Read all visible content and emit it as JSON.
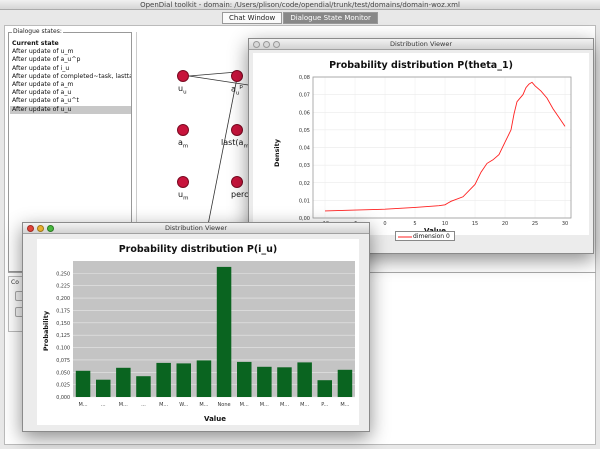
{
  "window": {
    "title": "OpenDial toolkit - domain: /Users/plison/code/opendial/trunk/test/domains/domain-woz.xml"
  },
  "tabs": [
    {
      "label": "Chat Window"
    },
    {
      "label": "Dialogue State Monitor"
    }
  ],
  "states_panel": {
    "legend": "Dialogue states:",
    "items": [
      "Current state",
      "After update of u_m",
      "After update of a_u^p",
      "After update of i_u",
      "After update of completed~task, lastta_m",
      "After update of a_m",
      "After update of a_u",
      "After update of a_u^t",
      "After update of u_u"
    ],
    "selected_index": 8
  },
  "lower_panel": {
    "label": "Co"
  },
  "graph": {
    "nodes": [
      {
        "label": "u",
        "sub": "u"
      },
      {
        "label": "a",
        "sub": "u",
        "sup": "p"
      },
      {
        "label": "a",
        "sub": "m"
      },
      {
        "label": "last(a",
        "sub": "m"
      },
      {
        "label": "u",
        "sub": "m"
      },
      {
        "label": "perceive"
      }
    ]
  },
  "viewer_right": {
    "window_title": "Distribution Viewer",
    "chart_data": {
      "type": "line",
      "title": "Probability distribution P(theta_1)",
      "xlabel": "Value",
      "ylabel": "Density",
      "xlim": [
        -12,
        31
      ],
      "ylim": [
        0,
        0.08
      ],
      "xticks": [
        "-10",
        "-5",
        "0",
        "5",
        "10",
        "15",
        "20",
        "25",
        "30"
      ],
      "yticks": [
        "0,00",
        "0,01",
        "0,02",
        "0,03",
        "0,04",
        "0,05",
        "0,06",
        "0,07",
        "0,08"
      ],
      "legend": "dimension 0",
      "legend_position": "bottom-center",
      "line_color": "#ff2020",
      "x": [
        -10,
        -5,
        0,
        5,
        9,
        10,
        10.5,
        11,
        13,
        15,
        16,
        17,
        18,
        19,
        20,
        21,
        21.5,
        22,
        23,
        23.5,
        24,
        24.5,
        25,
        26,
        27,
        28,
        29,
        30
      ],
      "y": [
        0.004,
        0.0045,
        0.005,
        0.006,
        0.007,
        0.0075,
        0.0085,
        0.0095,
        0.012,
        0.019,
        0.026,
        0.031,
        0.033,
        0.036,
        0.043,
        0.05,
        0.059,
        0.066,
        0.07,
        0.074,
        0.076,
        0.077,
        0.075,
        0.072,
        0.068,
        0.062,
        0.057,
        0.052
      ]
    }
  },
  "viewer_left": {
    "window_title": "Distribution Viewer",
    "chart_data": {
      "type": "bar",
      "title": "Probability distribution P(i_u)",
      "xlabel": "Value",
      "ylabel": "Probability",
      "ylim": [
        0,
        0.275
      ],
      "yticks": [
        "0,000",
        "0,025",
        "0,050",
        "0,075",
        "0,100",
        "0,125",
        "0,150",
        "0,175",
        "0,200",
        "0,225",
        "0,250"
      ],
      "bar_color": "#0a6420",
      "categories": [
        "M...",
        "...",
        "M...",
        "...",
        "M...",
        "W...",
        "M...",
        "None",
        "M...",
        "M...",
        "M...",
        "M...",
        "P...",
        "M..."
      ],
      "values": [
        0.053,
        0.035,
        0.059,
        0.042,
        0.069,
        0.068,
        0.074,
        0.263,
        0.071,
        0.061,
        0.06,
        0.07,
        0.034,
        0.055
      ]
    }
  }
}
